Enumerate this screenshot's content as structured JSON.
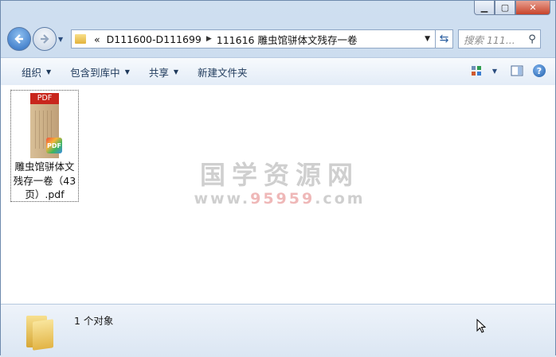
{
  "window": {
    "buttons": {
      "minimize": "▁",
      "maximize": "▢",
      "close": "✕"
    }
  },
  "nav": {
    "back_icon": "back-arrow-icon",
    "forward_icon": "forward-arrow-icon",
    "history_dropdown_icon": "chevron-down-icon",
    "breadcrumb": {
      "overflow": "«",
      "segments": [
        "D111600-D111699",
        "111616 雕虫馆骈体文残存一卷"
      ]
    },
    "search_placeholder": "搜索 111...",
    "refresh_icon": "refresh-icon"
  },
  "toolbar": {
    "organize": "组织",
    "include_library": "包含到库中",
    "share": "共享",
    "new_folder": "新建文件夹"
  },
  "content": {
    "file": {
      "icon_label": "PDF",
      "badge_label": "PDF",
      "name_lines": [
        "雕虫馆骈体文",
        "残存一卷（43",
        "页）.pdf"
      ]
    },
    "watermark": {
      "line1": "国学资源网",
      "line2_prefix": "www.",
      "line2_mid": "95959",
      "line2_suffix": ".com"
    }
  },
  "status": {
    "count": "1 个对象"
  },
  "colors": {
    "pdf_red": "#c8261c",
    "titlebar": "#cfdff0",
    "close_red": "#c7442b"
  }
}
